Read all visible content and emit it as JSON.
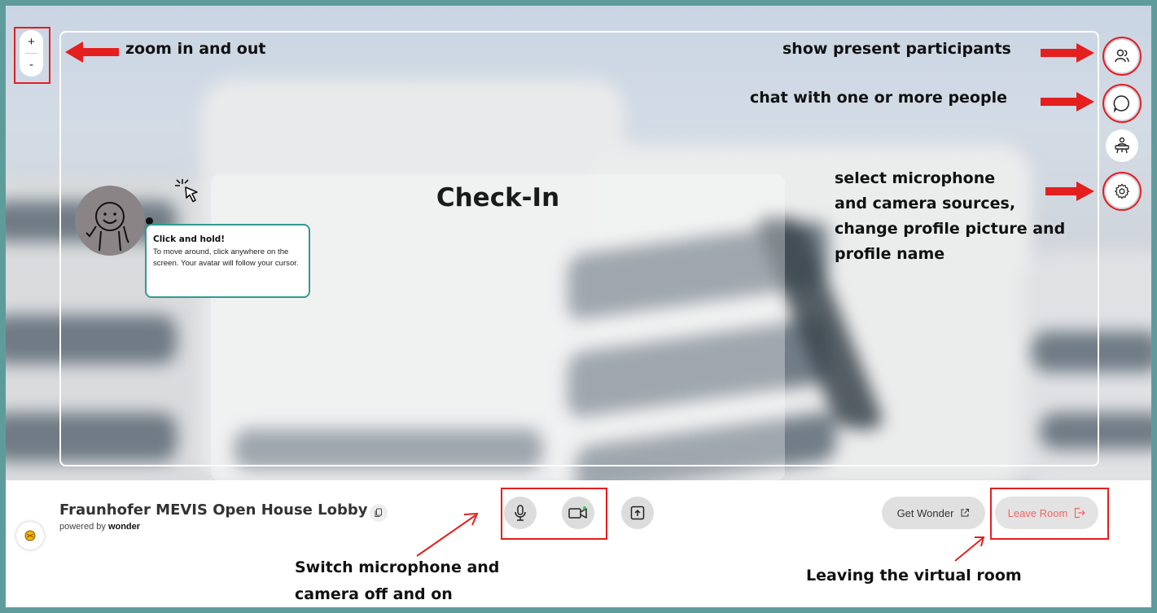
{
  "zoom": {
    "in_label": "+",
    "out_label": "-"
  },
  "room": {
    "area_title": "Check-In"
  },
  "tooltip": {
    "title": "Click and hold!",
    "body": "To move around, click anywhere on the screen. Your avatar will follow your cursor."
  },
  "annotations": {
    "zoom": "zoom in and out",
    "participants": "show present participants",
    "chat": "chat with one or more people",
    "settings_line1": "select microphone",
    "settings_line2": "and camera sources,",
    "settings_line3": "change profile picture and",
    "settings_line4": "profile name",
    "media_line1": "Switch microphone and",
    "media_line2": "camera off and on",
    "leave": "Leaving the virtual room"
  },
  "sidebar": {
    "icons": [
      "participants-icon",
      "chat-icon",
      "presenter-icon",
      "settings-icon"
    ]
  },
  "bottom_bar": {
    "room_name": "Fraunhofer MEVIS Open House Lobby",
    "powered_prefix": "powered by",
    "powered_brand": "wonder",
    "get_wonder": "Get Wonder",
    "leave_room": "Leave Room"
  },
  "colors": {
    "frame": "#5e9c9b",
    "annotation_red": "#e51e1e",
    "tooltip_border": "#2f9a93",
    "leave_text": "#f06565",
    "camera_active_dot": "#2ecc40"
  }
}
